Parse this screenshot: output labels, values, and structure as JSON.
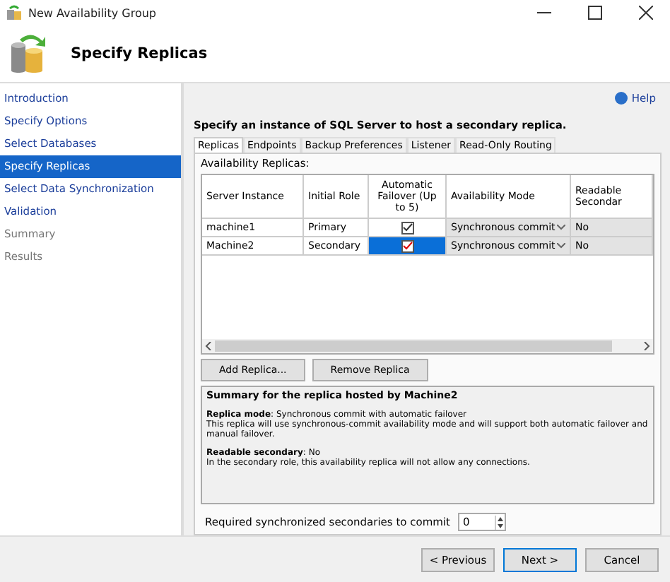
{
  "window": {
    "title": "New Availability Group"
  },
  "header": {
    "title": "Specify Replicas"
  },
  "nav": [
    {
      "label": "Introduction",
      "selected": false,
      "disabled": false
    },
    {
      "label": "Specify Options",
      "selected": false,
      "disabled": false
    },
    {
      "label": "Select Databases",
      "selected": false,
      "disabled": false
    },
    {
      "label": "Specify Replicas",
      "selected": true,
      "disabled": false
    },
    {
      "label": "Select Data Synchronization",
      "selected": false,
      "disabled": false
    },
    {
      "label": "Validation",
      "selected": false,
      "disabled": false
    },
    {
      "label": "Summary",
      "selected": false,
      "disabled": true
    },
    {
      "label": "Results",
      "selected": false,
      "disabled": true
    }
  ],
  "help": "Help",
  "instruction": "Specify an instance of SQL Server to host a secondary replica.",
  "tabs": [
    {
      "label": "Replicas",
      "selected": true
    },
    {
      "label": "Endpoints",
      "selected": false
    },
    {
      "label": "Backup Preferences",
      "selected": false
    },
    {
      "label": "Listener",
      "selected": false
    },
    {
      "label": "Read-Only Routing",
      "selected": false
    }
  ],
  "replicas_label": "Availability Replicas:",
  "table": {
    "columns": [
      "Server Instance",
      "Initial Role",
      "Automatic Failover (Up to 5)",
      "Availability Mode",
      "Readable Secondar"
    ],
    "rows": [
      {
        "server": "machine1",
        "role": "Primary",
        "failover": true,
        "mode": "Synchronous commit",
        "readable": "No",
        "selected": false
      },
      {
        "server": "Machine2",
        "role": "Secondary",
        "failover": true,
        "mode": "Synchronous commit",
        "readable": "No",
        "selected": true
      }
    ]
  },
  "buttons": [
    "Add Replica...",
    "Remove Replica"
  ],
  "summary": {
    "title": "Summary for the replica hosted by Machine2",
    "paragraphs": [
      "**Replica mode**: Synchronous commit with automatic failover",
      "This replica will use synchronous-commit availability mode and will support both automatic failover and manual failover.",
      "**Readable secondary**: No",
      "In the secondary role, this availability replica will not allow any connections."
    ]
  },
  "required": {
    "label": "Required synchronized secondaries to commit",
    "value": "0"
  },
  "footer_buttons": [
    {
      "label": "< Previous",
      "default": false
    },
    {
      "label": "Next >",
      "default": true
    },
    {
      "label": "Cancel",
      "default": false
    }
  ]
}
